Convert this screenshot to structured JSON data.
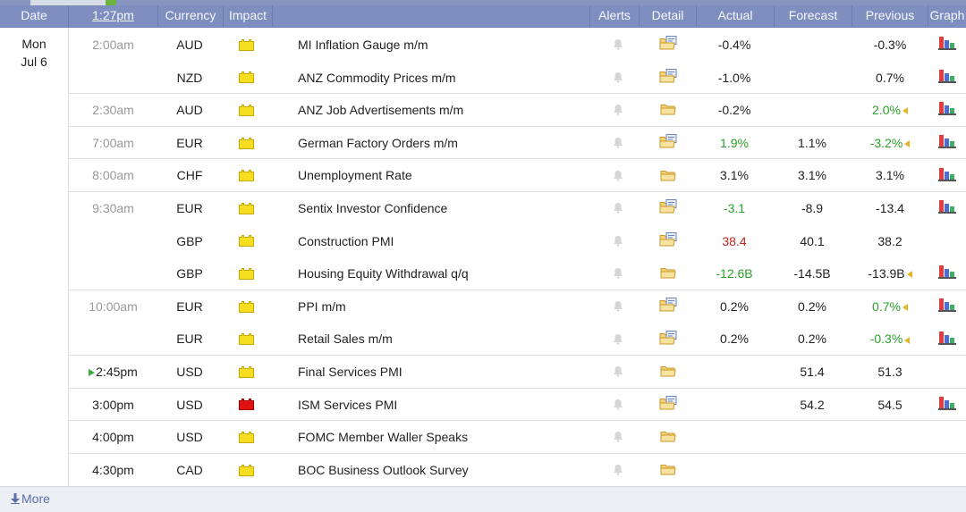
{
  "header": {
    "date": "Date",
    "time": "1:27pm",
    "currency": "Currency",
    "impact": "Impact",
    "alerts": "Alerts",
    "detail": "Detail",
    "actual": "Actual",
    "forecast": "Forecast",
    "previous": "Previous",
    "graph": "Graph"
  },
  "date_group": {
    "day": "Mon",
    "date": "Jul 6"
  },
  "colors": {
    "header_bg": "#7e8fbf",
    "better": "#2ca12c",
    "worse": "#c0261e",
    "impact_medium": "#f5dd1f",
    "impact_high": "#e01212"
  },
  "events": [
    {
      "time": "2:00am",
      "currency": "AUD",
      "impact": "medium",
      "event": "MI Inflation Gauge m/m",
      "detail_icon": "folder-report-icon",
      "actual": "-0.4%",
      "actual_class": "",
      "forecast": "",
      "previous": "-0.3%",
      "previous_class": "",
      "revised": false,
      "graph": true
    },
    {
      "time": "",
      "currency": "NZD",
      "impact": "medium",
      "event": "ANZ Commodity Prices m/m",
      "detail_icon": "folder-report-icon",
      "actual": "-1.0%",
      "actual_class": "",
      "forecast": "",
      "previous": "0.7%",
      "previous_class": "",
      "revised": false,
      "graph": true
    },
    {
      "time": "2:30am",
      "currency": "AUD",
      "impact": "medium",
      "event": "ANZ Job Advertisements m/m",
      "detail_icon": "folder-icon",
      "actual": "-0.2%",
      "actual_class": "",
      "forecast": "",
      "previous": "2.0%",
      "previous_class": "green",
      "revised": true,
      "graph": true
    },
    {
      "time": "7:00am",
      "currency": "EUR",
      "impact": "medium",
      "event": "German Factory Orders m/m",
      "detail_icon": "folder-report-icon",
      "actual": "1.9%",
      "actual_class": "green",
      "forecast": "1.1%",
      "previous": "-3.2%",
      "previous_class": "green",
      "revised": true,
      "graph": true
    },
    {
      "time": "8:00am",
      "currency": "CHF",
      "impact": "medium",
      "event": "Unemployment Rate",
      "detail_icon": "folder-icon",
      "actual": "3.1%",
      "actual_class": "",
      "forecast": "3.1%",
      "previous": "3.1%",
      "previous_class": "",
      "revised": false,
      "graph": true
    },
    {
      "time": "9:30am",
      "currency": "EUR",
      "impact": "medium",
      "event": "Sentix Investor Confidence",
      "detail_icon": "folder-report-icon",
      "actual": "-3.1",
      "actual_class": "green",
      "forecast": "-8.9",
      "previous": "-13.4",
      "previous_class": "",
      "revised": false,
      "graph": true
    },
    {
      "time": "",
      "currency": "GBP",
      "impact": "medium",
      "event": "Construction PMI",
      "detail_icon": "folder-report-icon",
      "actual": "38.4",
      "actual_class": "red",
      "forecast": "40.1",
      "previous": "38.2",
      "previous_class": "",
      "revised": false,
      "graph": false
    },
    {
      "time": "",
      "currency": "GBP",
      "impact": "medium",
      "event": "Housing Equity Withdrawal q/q",
      "detail_icon": "folder-icon",
      "actual": "-12.6B",
      "actual_class": "green",
      "forecast": "-14.5B",
      "previous": "-13.9B",
      "previous_class": "",
      "revised": true,
      "graph": true
    },
    {
      "time": "10:00am",
      "currency": "EUR",
      "impact": "medium",
      "event": "PPI m/m",
      "detail_icon": "folder-report-icon",
      "actual": "0.2%",
      "actual_class": "",
      "forecast": "0.2%",
      "previous": "0.7%",
      "previous_class": "green",
      "revised": true,
      "graph": true
    },
    {
      "time": "",
      "currency": "EUR",
      "impact": "medium",
      "event": "Retail Sales m/m",
      "detail_icon": "folder-report-icon",
      "actual": "0.2%",
      "actual_class": "",
      "forecast": "0.2%",
      "previous": "-0.3%",
      "previous_class": "green",
      "revised": true,
      "graph": true
    },
    {
      "time": "2:45pm",
      "currency": "USD",
      "impact": "medium",
      "event": "Final Services PMI",
      "detail_icon": "folder-icon",
      "actual": "",
      "actual_class": "",
      "forecast": "51.4",
      "previous": "51.3",
      "previous_class": "",
      "revised": false,
      "graph": false,
      "upnext": true
    },
    {
      "time": "3:00pm",
      "currency": "USD",
      "impact": "high",
      "event": "ISM Services PMI",
      "detail_icon": "folder-report-icon",
      "actual": "",
      "actual_class": "",
      "forecast": "54.2",
      "previous": "54.5",
      "previous_class": "",
      "revised": false,
      "graph": true
    },
    {
      "time": "4:00pm",
      "currency": "USD",
      "impact": "medium",
      "event": "FOMC Member Waller Speaks",
      "detail_icon": "folder-icon",
      "actual": "",
      "actual_class": "",
      "forecast": "",
      "previous": "",
      "previous_class": "",
      "revised": false,
      "graph": false
    },
    {
      "time": "4:30pm",
      "currency": "CAD",
      "impact": "medium",
      "event": "BOC Business Outlook Survey",
      "detail_icon": "folder-icon",
      "actual": "",
      "actual_class": "",
      "forecast": "",
      "previous": "",
      "previous_class": "",
      "revised": false,
      "graph": false
    }
  ],
  "footer": {
    "more_label": "More",
    "more_icon": "down-arrow-icon"
  }
}
